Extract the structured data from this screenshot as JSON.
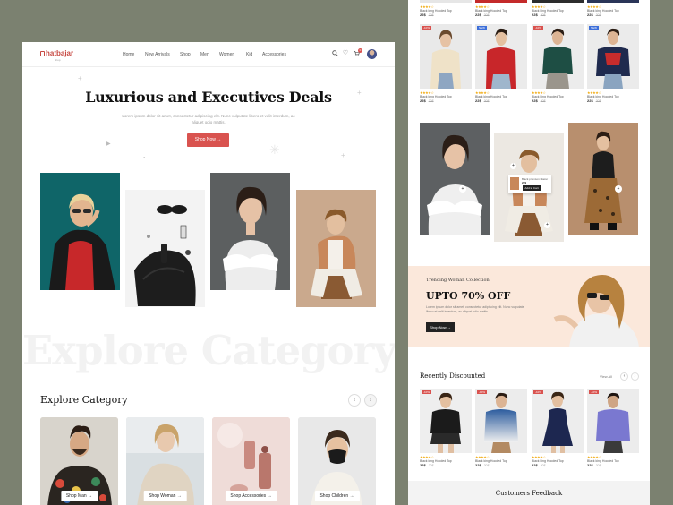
{
  "nav": {
    "brand": "hatbajar",
    "brand_sub": "shop",
    "links": [
      "Home",
      "New Arrivals",
      "Shop",
      "Men",
      "Women",
      "Kid",
      "Accessories"
    ],
    "cart_count": "0"
  },
  "hero": {
    "title": "Luxurious and Executives Deals",
    "subtitle": "Lorem ipsum dolor sit amet, consectetur adipiscing elit. Nunc vulputate libero et velit interdum, ac aliquet odio mattis.",
    "cta": "Shop Now",
    "cta_icon": "arrow-right-icon"
  },
  "categories": {
    "watermark": "Explore Category",
    "title": "Explore Category",
    "items": [
      {
        "label": "Shop Man"
      },
      {
        "label": "Shop Woman"
      },
      {
        "label": "Shop Accessories"
      },
      {
        "label": "Shop Children"
      }
    ]
  },
  "top_row_products": [
    {
      "name": "Black king Hooded Top",
      "price": "22$",
      "old": "30$"
    },
    {
      "name": "Black king Hooded Top",
      "price": "22$",
      "old": "30$"
    },
    {
      "name": "Black king Hooded Top",
      "price": "22$",
      "old": "30$"
    },
    {
      "name": "Black king Hooded Top",
      "price": "22$",
      "old": "30$"
    }
  ],
  "products": [
    {
      "tag": "-10%",
      "tag_color": "red",
      "name": "Black king Hooded Top",
      "price": "22$",
      "old": "30$"
    },
    {
      "tag": "NEW",
      "tag_color": "blue",
      "name": "Black king Hooded Top",
      "price": "22$",
      "old": "30$"
    },
    {
      "tag": "-10%",
      "tag_color": "red",
      "name": "Black king Hooded Top",
      "price": "22$",
      "old": "30$"
    },
    {
      "tag": "NEW",
      "tag_color": "blue",
      "name": "Black king Hooded Top",
      "price": "22$",
      "old": "30$"
    }
  ],
  "hotspot_card": {
    "name": "Black premium Blazer",
    "price": "22$",
    "btn": "Add to Cart"
  },
  "promo": {
    "kicker": "Trending Woman Collection",
    "title": "UPTO 70% OFF",
    "body": "Lorem ipsum dolor sit amet, consectetur adipiscing elit. Nunc vulputate libero et velit interdum, ac aliquet odio mattis.",
    "cta": "Shop Now"
  },
  "discounted": {
    "title": "Recently Discounted",
    "view_all": "View All",
    "items": [
      {
        "tag": "-10%",
        "name": "Black king Hooded Top",
        "price": "22$",
        "old": "30$"
      },
      {
        "tag": "-10%",
        "name": "Black king Hooded Top",
        "price": "22$",
        "old": "30$"
      },
      {
        "tag": "-10%",
        "name": "Black king Hooded Top",
        "price": "22$",
        "old": "30$"
      },
      {
        "tag": "-10%",
        "name": "Black king Hooded Top",
        "price": "22$",
        "old": "30$"
      }
    ]
  },
  "feedback": {
    "title": "Customers Feedback"
  },
  "stars": "★★★★☆",
  "colors": {
    "accent": "#d9534f",
    "promo_bg": "#fbe8db",
    "backdrop": "#7b8170"
  }
}
